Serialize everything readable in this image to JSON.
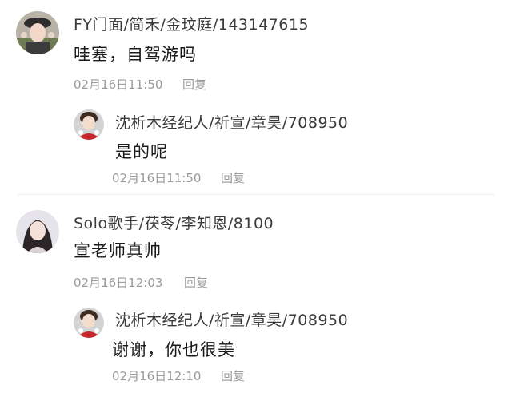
{
  "comments": [
    {
      "author": "FY门面/简禾/金玟庭/143147615",
      "text": "哇塞，自驾游吗",
      "date": "02月16日11:50",
      "reply_label": "回复",
      "avatar_icon": "avatar-woman-hat",
      "replies": [
        {
          "author": "沈析木经纪人/祈宣/章昊/708950",
          "text": "是的呢",
          "date": "02月16日11:50",
          "reply_label": "回复",
          "avatar_icon": "avatar-man-red"
        }
      ]
    },
    {
      "author": "Solo歌手/茯苓/李知恩/8100",
      "text": "宣老师真帅",
      "date": "02月16日12:03",
      "reply_label": "回复",
      "avatar_icon": "avatar-woman-longhair",
      "replies": [
        {
          "author": "沈析木经纪人/祈宣/章昊/708950",
          "text": "谢谢，你也很美",
          "date": "02月16日12:10",
          "reply_label": "回复",
          "avatar_icon": "avatar-man-red"
        }
      ]
    }
  ]
}
